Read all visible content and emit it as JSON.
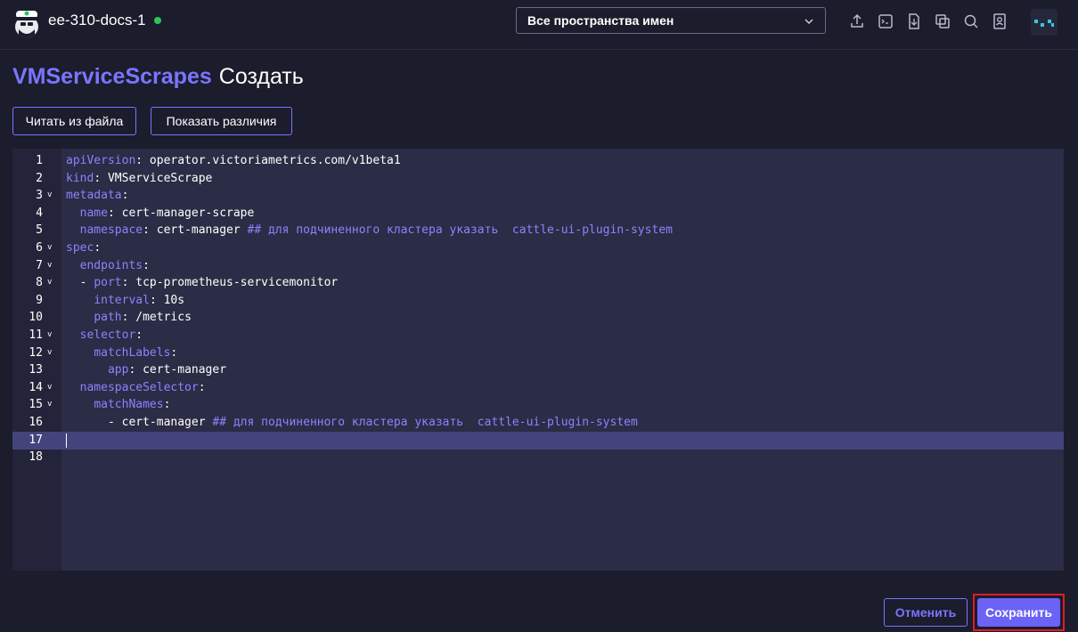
{
  "header": {
    "cluster_name": "ee-310-docs-1",
    "cluster_status_color": "#2fc35d",
    "namespace_select": {
      "value": "Все пространства имен"
    },
    "tools": [
      {
        "icon": "upload-icon"
      },
      {
        "icon": "terminal-icon"
      },
      {
        "icon": "download-icon"
      },
      {
        "icon": "copy-icon"
      },
      {
        "icon": "search-icon"
      },
      {
        "icon": "account-icon"
      }
    ]
  },
  "page": {
    "resource": "VMServiceScrapes",
    "action": "Создать"
  },
  "toolbar": {
    "read_file": "Читать из файла",
    "show_diff": "Показать различия"
  },
  "editor": {
    "lines": [
      {
        "num": "1",
        "fold": false,
        "key": "apiVersion",
        "rest": ": operator.victoriametrics.com/v1beta1",
        "indent": "",
        "comment": ""
      },
      {
        "num": "2",
        "fold": false,
        "key": "kind",
        "rest": ": VMServiceScrape",
        "indent": "",
        "comment": ""
      },
      {
        "num": "3",
        "fold": true,
        "key": "metadata",
        "rest": ":",
        "indent": "",
        "comment": ""
      },
      {
        "num": "4",
        "fold": false,
        "key": "name",
        "rest": ": cert-manager-scrape",
        "indent": "  ",
        "comment": ""
      },
      {
        "num": "5",
        "fold": false,
        "key": "namespace",
        "rest": ": cert-manager ",
        "indent": "  ",
        "comment": "## для подчиненного кластера указать  cattle-ui-plugin-system"
      },
      {
        "num": "6",
        "fold": true,
        "key": "spec",
        "rest": ":",
        "indent": "",
        "comment": ""
      },
      {
        "num": "7",
        "fold": true,
        "key": "endpoints",
        "rest": ":",
        "indent": "  ",
        "comment": ""
      },
      {
        "num": "8",
        "fold": true,
        "key": "port",
        "rest": ": tcp-prometheus-servicemonitor",
        "indent": "  - ",
        "comment": ""
      },
      {
        "num": "9",
        "fold": false,
        "key": "interval",
        "rest": ": 10s",
        "indent": "    ",
        "comment": ""
      },
      {
        "num": "10",
        "fold": false,
        "key": "path",
        "rest": ": /metrics",
        "indent": "    ",
        "comment": ""
      },
      {
        "num": "11",
        "fold": true,
        "key": "selector",
        "rest": ":",
        "indent": "  ",
        "comment": ""
      },
      {
        "num": "12",
        "fold": true,
        "key": "matchLabels",
        "rest": ":",
        "indent": "    ",
        "comment": ""
      },
      {
        "num": "13",
        "fold": false,
        "key": "app",
        "rest": ": cert-manager",
        "indent": "      ",
        "comment": ""
      },
      {
        "num": "14",
        "fold": true,
        "key": "namespaceSelector",
        "rest": ":",
        "indent": "  ",
        "comment": ""
      },
      {
        "num": "15",
        "fold": true,
        "key": "matchNames",
        "rest": ":",
        "indent": "    ",
        "comment": ""
      },
      {
        "num": "16",
        "fold": false,
        "key": "",
        "rest": "- cert-manager ",
        "indent": "      ",
        "comment": "## для подчиненного кластера указать  cattle-ui-plugin-system"
      },
      {
        "num": "17",
        "fold": false,
        "key": "",
        "rest": "",
        "indent": "",
        "comment": ""
      },
      {
        "num": "18",
        "fold": false,
        "key": "",
        "rest": "",
        "indent": "",
        "comment": ""
      }
    ],
    "active_line": "17"
  },
  "footer": {
    "cancel": "Отменить",
    "save": "Сохранить"
  },
  "colors": {
    "accent": "#7b75ff",
    "primary_button": "#6b63f5",
    "highlight_border": "#e01c26",
    "background": "#1b1c2c",
    "editor_bg": "#2b2c45"
  }
}
